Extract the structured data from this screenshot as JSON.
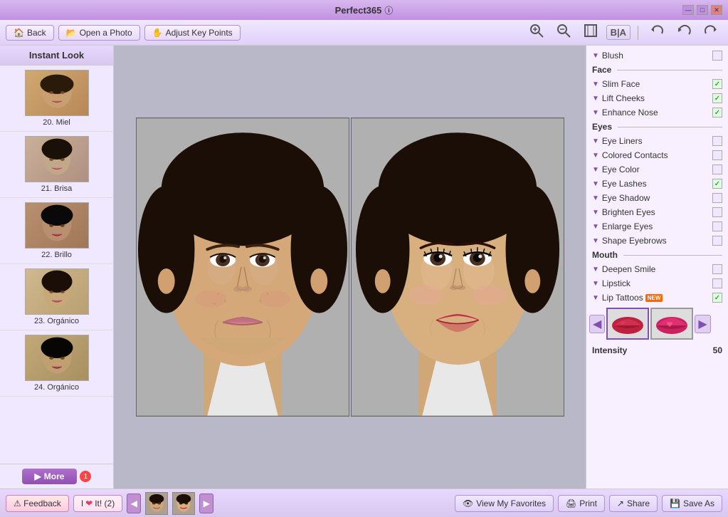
{
  "app": {
    "title": "Perfect365",
    "info_icon": "ⓘ"
  },
  "title_bar": {
    "title": "Perfect365",
    "minimize_label": "—",
    "restore_label": "□",
    "close_label": "✕"
  },
  "toolbar": {
    "back_label": "Back",
    "open_photo_label": "Open a Photo",
    "adjust_key_points_label": "Adjust Key Points",
    "zoom_in_label": "🔍+",
    "zoom_out_label": "🔍−",
    "fit_label": "⊡",
    "bia_label": "B|A",
    "undo_label": "↩",
    "undo2_label": "↺",
    "redo_label": "↻"
  },
  "sidebar": {
    "title": "Instant Look",
    "items": [
      {
        "id": 20,
        "label": "20. Miel",
        "bg": "#d0a870"
      },
      {
        "id": 21,
        "label": "21. Brisa",
        "bg": "#c8a880"
      },
      {
        "id": 22,
        "label": "22. Brillo",
        "bg": "#b89060"
      },
      {
        "id": 23,
        "label": "23. Orgánico",
        "bg": "#d0b890"
      },
      {
        "id": 24,
        "label": "24. Orgánico",
        "bg": "#c0a878"
      }
    ],
    "more_label": "More",
    "more_badge": "1"
  },
  "right_panel": {
    "blush_label": "Blush",
    "face_section": "Face",
    "face_items": [
      {
        "label": "Slim Face",
        "checked": true
      },
      {
        "label": "Lift Cheeks",
        "checked": true
      },
      {
        "label": "Enhance Nose",
        "checked": true
      }
    ],
    "eyes_section": "Eyes",
    "eyes_items": [
      {
        "label": "Eye Liners",
        "checked": false
      },
      {
        "label": "Colored Contacts",
        "checked": false
      },
      {
        "label": "Eye Color",
        "checked": false
      },
      {
        "label": "Eye Lashes",
        "checked": true
      },
      {
        "label": "Eye Shadow",
        "checked": false
      },
      {
        "label": "Brighten Eyes",
        "checked": false
      },
      {
        "label": "Enlarge Eyes",
        "checked": false
      },
      {
        "label": "Shape Eyebrows",
        "checked": false
      }
    ],
    "mouth_section": "Mouth",
    "mouth_items": [
      {
        "label": "Deepen Smile",
        "checked": false
      },
      {
        "label": "Lipstick",
        "checked": false
      },
      {
        "label": "Lip Tattoos",
        "checked": true,
        "new": true
      }
    ],
    "intensity_label": "Intensity",
    "intensity_value": "50",
    "prev_arrow": "◀",
    "next_arrow": "▶"
  },
  "bottom_bar": {
    "feedback_label": "Feedback",
    "ilike_label": "I",
    "ilike_heart": "❤",
    "ilike_suffix": "It! (2)",
    "prev_label": "◀",
    "next_label": "▶",
    "view_favorites_label": "View My Favorites",
    "print_label": "Print",
    "share_label": "Share",
    "save_as_label": "Save As"
  }
}
